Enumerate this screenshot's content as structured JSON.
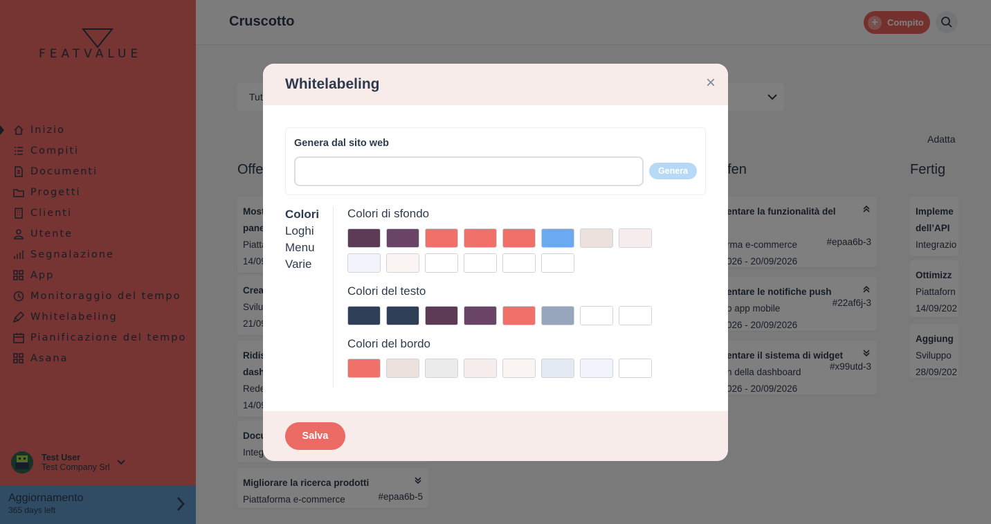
{
  "sidebar": {
    "logo_text": "FEATVALUE",
    "items": [
      {
        "label": "Inizio",
        "icon": "home-icon"
      },
      {
        "label": "Compiti",
        "icon": "list-icon"
      },
      {
        "label": "Documenti",
        "icon": "document-icon"
      },
      {
        "label": "Progetti",
        "icon": "folder-icon"
      },
      {
        "label": "Clienti",
        "icon": "building-icon"
      },
      {
        "label": "Utente",
        "icon": "user-icon"
      },
      {
        "label": "Segnalazione",
        "icon": "chart-icon"
      },
      {
        "label": "App",
        "icon": "grid-icon"
      },
      {
        "label": "Monitoraggio del tempo",
        "icon": "clock-icon"
      },
      {
        "label": "Whitelabeling",
        "icon": "brush-icon"
      },
      {
        "label": "Pianificazione del tempo",
        "icon": "calendar-icon"
      },
      {
        "label": "Asana",
        "icon": "grid-icon"
      }
    ],
    "user": {
      "name": "Test User",
      "company": "Test Company Srl"
    },
    "upgrade": {
      "title": "Aggiornamento",
      "subtitle": "365 days left"
    }
  },
  "header": {
    "title": "Cruscotto",
    "task_button": "Compito"
  },
  "board": {
    "filter_label": "Tut",
    "adapt_label": "Adatta",
    "columns": [
      {
        "title": "Offe"
      },
      {
        "title": "üfen"
      },
      {
        "title": "Fertig"
      }
    ],
    "col1_cards": [
      {
        "title": "Most",
        "line2": "pane",
        "sub": "Piatta",
        "date": "14/09"
      },
      {
        "title": "Crea",
        "sub": "Svilu",
        "date": "21/09"
      },
      {
        "title": "Ridis",
        "line2": "dash",
        "sub": "Rede",
        "date": "14/09"
      },
      {
        "title": "Docu",
        "sub": "Integ"
      },
      {
        "title": "Migliorare la ricerca prodotti",
        "sub": "Piattaforma e-commerce",
        "id": "#epaa6b-5"
      }
    ],
    "col2_cards": [
      {
        "title": "entare la funzionalità del",
        "sub": "rma e-commerce",
        "id": "#epaa6b-3",
        "date": "026 - 20/09/2026"
      },
      {
        "title": "entare le notifiche push",
        "sub": "o app mobile",
        "id": "#22af6j-3",
        "date": "026 - 20/09/2026"
      },
      {
        "title": "entare il sistema di widget",
        "sub": "n della dashboard",
        "id": "#x99utd-3",
        "date": "026 - 20/09/2026"
      }
    ],
    "col3_cards": [
      {
        "title": "Impleme",
        "line2": "dell’API",
        "sub": "Integrazio"
      },
      {
        "title": "Ottimizz",
        "sub": "Piattaforn",
        "date": "14/09/202"
      },
      {
        "title": "Aggiung",
        "sub": "Sviluppo",
        "date": "28/09/202"
      }
    ]
  },
  "modal": {
    "title": "Whitelabeling",
    "close": "×",
    "generate_label": "Genera dal sito web",
    "generate_value": "",
    "generate_button": "Genera",
    "tabs": [
      "Colori",
      "Loghi",
      "Menu",
      "Varie"
    ],
    "background_title": "Colori di sfondo",
    "background_colors": [
      "#5e3b55",
      "#6a4466",
      "#f0706a",
      "#f0706a",
      "#f0706a",
      "#6aaaf0",
      "#ede1de",
      "#f8eded",
      "#f1f4fa",
      "#faf5f3",
      "#ffffff",
      "#ffffff",
      "#ffffff",
      "#ffffff"
    ],
    "text_title": "Colori del testo",
    "text_colors": [
      "#2f3f57",
      "#2f3f57",
      "#5e3b55",
      "#6a4466",
      "#f0706a",
      "#97a5bd",
      "#ffffff",
      "#ffffff"
    ],
    "border_title": "Colori del bordo",
    "border_colors": [
      "#f0706a",
      "#ede1de",
      "#ececec",
      "#f8eded",
      "#faf5f3",
      "#e4eaf3",
      "#f1f4fa",
      "#ffffff"
    ],
    "save_button": "Salva"
  }
}
